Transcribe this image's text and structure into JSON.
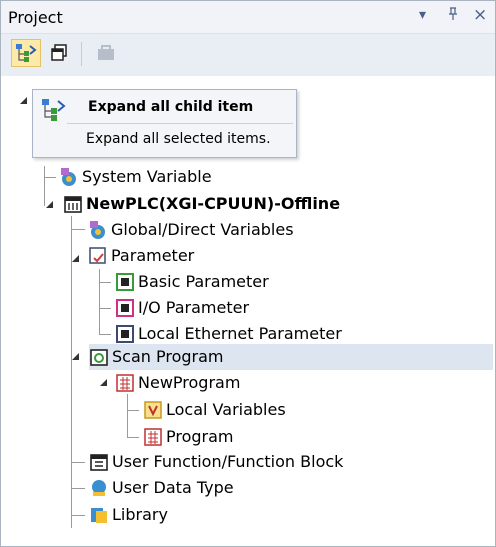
{
  "panel": {
    "title": "Project",
    "controls": {
      "dropdown": "▾",
      "pin": "ᵽ",
      "close": "×"
    }
  },
  "toolbar": {
    "buttons": [
      {
        "name": "expand-all-child-item",
        "icon": "expand-tree-icon",
        "active": true
      },
      {
        "name": "collapse-all",
        "icon": "collapse-tree-icon",
        "active": false
      },
      {
        "name": "disabled-tool",
        "icon": "folder-icon",
        "active": false
      }
    ]
  },
  "tooltip": {
    "title": "Expand all child item",
    "description": "Expand all selected items."
  },
  "tree": {
    "items": [
      {
        "label": "System Variable",
        "icon": "system-variable-icon"
      },
      {
        "label": "NewPLC(XGI-CPUUN)-Offline",
        "icon": "plc-icon"
      },
      {
        "label": "Global/Direct Variables",
        "icon": "global-variables-icon"
      },
      {
        "label": "Parameter",
        "icon": "parameter-icon"
      },
      {
        "label": "Basic Parameter",
        "icon": "basic-parameter-icon"
      },
      {
        "label": "I/O Parameter",
        "icon": "io-parameter-icon"
      },
      {
        "label": "Local Ethernet Parameter",
        "icon": "ethernet-parameter-icon"
      },
      {
        "label": "Scan Program",
        "icon": "scan-program-icon"
      },
      {
        "label": "NewProgram",
        "icon": "program-icon"
      },
      {
        "label": "Local Variables",
        "icon": "local-variables-icon"
      },
      {
        "label": "Program",
        "icon": "program-icon"
      },
      {
        "label": "User Function/Function Block",
        "icon": "function-block-icon"
      },
      {
        "label": "User Data Type",
        "icon": "data-type-icon"
      },
      {
        "label": "Library",
        "icon": "library-icon"
      }
    ],
    "selected": "Scan Program"
  },
  "colors": {
    "titlebar": "#f1f3f8",
    "toolbar": "#e9edf4",
    "selection": "#dde5f0",
    "tooltip_bg": "#f4f5f8"
  }
}
